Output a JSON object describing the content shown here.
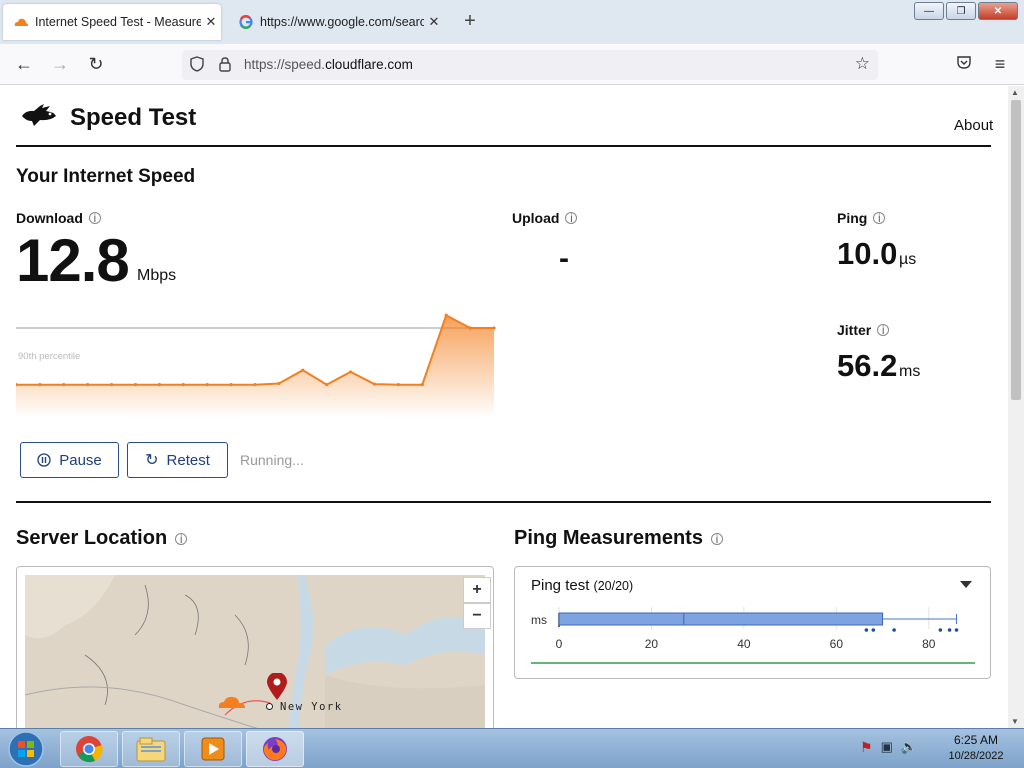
{
  "browser": {
    "tabs": [
      {
        "title": "Internet Speed Test - Measure Network Performance | Cloudflare",
        "active": true,
        "icon": "cloudflare-icon"
      },
      {
        "title": "https://www.google.com/search",
        "active": false,
        "icon": "google-icon"
      }
    ],
    "url_prefix": "https://speed.",
    "url_domain": "cloudflare.com",
    "new_tab_label": "+"
  },
  "site": {
    "title": "Speed Test",
    "about": "About"
  },
  "speed": {
    "heading": "Your Internet Speed",
    "download_label": "Download",
    "download_value": "12.8",
    "download_unit": "Mbps",
    "upload_label": "Upload",
    "upload_value": "-",
    "ping_label": "Ping",
    "ping_value": "10.0",
    "ping_unit": "µs",
    "jitter_label": "Jitter",
    "jitter_value": "56.2",
    "jitter_unit": "ms",
    "percentile_label": "90th percentile",
    "accent_color": "#f38020"
  },
  "controls": {
    "pause": "Pause",
    "retest": "Retest",
    "status": "Running..."
  },
  "server": {
    "heading": "Server Location",
    "city": "New York",
    "zoom_in": "+",
    "zoom_out": "−"
  },
  "ping_measurements": {
    "heading": "Ping Measurements",
    "test_title": "Ping test",
    "test_count": "(20/20)",
    "axis_unit": "ms",
    "ticks": [
      "0",
      "20",
      "40",
      "60",
      "80"
    ]
  },
  "chart_data": [
    {
      "type": "line",
      "x": [
        0,
        1,
        2,
        3,
        4,
        5,
        6,
        7,
        8,
        9,
        10,
        11,
        12,
        13,
        14,
        15,
        16,
        17,
        18,
        19,
        20
      ],
      "values": [
        3.0,
        3.0,
        3.0,
        3.0,
        3.0,
        3.0,
        3.0,
        3.0,
        3.0,
        3.0,
        3.0,
        3.2,
        5.5,
        3.0,
        5.2,
        3.1,
        3.0,
        3.0,
        15.0,
        12.8,
        12.8
      ],
      "ylabel": "Mbps",
      "reference_line": {
        "label": "90th percentile",
        "value": 12.8
      }
    },
    {
      "type": "box",
      "title": "Ping test",
      "xlabel": "ms",
      "xlim": [
        0,
        90
      ],
      "ticks": [
        0,
        20,
        40,
        60,
        80
      ],
      "whisker_low": 0,
      "q1": 0,
      "median": 27,
      "q3": 70,
      "whisker_high": 86,
      "outliers": [
        66.5,
        68,
        72.5,
        82.5,
        84.5,
        86
      ]
    }
  ],
  "taskbar": {
    "time": "6:25 AM",
    "date": "10/28/2022",
    "apps": [
      "chrome-icon",
      "file-explorer-icon",
      "media-player-icon",
      "firefox-icon"
    ]
  }
}
